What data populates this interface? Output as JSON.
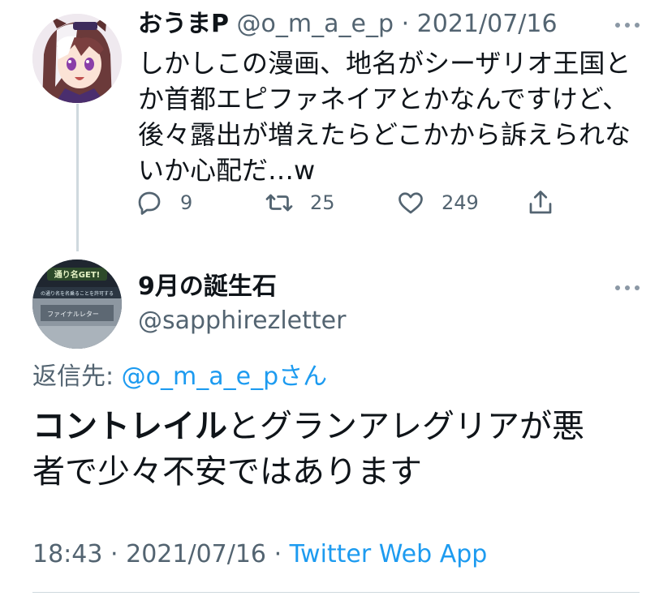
{
  "parent_tweet": {
    "display_name": "おうまP",
    "handle": "@o_m_a_e_p",
    "separator": "·",
    "date": "2021/07/16",
    "text_lines": [
      "しかしこの漫画、地名がシーザリオ王国と",
      "か首都エピファネイアとかなんですけど、",
      "後々露出が増えたらどこかから訴えられな",
      "いか心配だ…w"
    ],
    "counts": {
      "replies": "9",
      "retweets": "25",
      "likes": "249"
    }
  },
  "reply_tweet": {
    "display_name": "9月の誕生石",
    "handle": "@sapphirezletter",
    "replying_to_label": "返信先:",
    "replying_to_handle": "@o_m_a_e_pさん",
    "text_bold": "コントレイル",
    "text_rest_line1": "とグランアレグリアが悪",
    "text_line2": "者で少々不安ではあります",
    "avatar_texts": [
      "通り名GET!",
      "の通り名を名乗ることを許可する",
      "ファイナルレター"
    ],
    "time": "18:43",
    "separator": "·",
    "date": "2021/07/16",
    "separator2": "·",
    "source_app": "Twitter Web App"
  },
  "colors": {
    "text": "#0f1419",
    "secondary": "#536471",
    "accent": "#1d9bf0",
    "divider": "#cfd9de"
  },
  "icons": [
    "reply-icon",
    "retweet-icon",
    "like-icon",
    "share-icon",
    "more-icon"
  ]
}
